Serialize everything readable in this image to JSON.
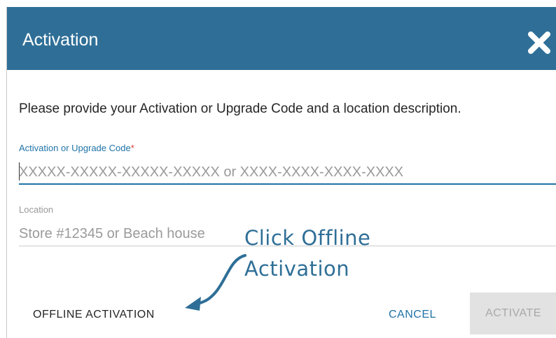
{
  "dialog": {
    "title": "Activation",
    "close_icon": "close-icon",
    "prompt": "Please provide your Activation or Upgrade Code and a location description.",
    "code_field": {
      "label": "Activation or Upgrade Code",
      "required_marker": "*",
      "placeholder": "XXXXX-XXXXX-XXXXX-XXXXX or XXXX-XXXX-XXXX-XXXX",
      "value": ""
    },
    "location_field": {
      "label": "Location",
      "placeholder": "Store #12345 or Beach house",
      "value": ""
    },
    "buttons": {
      "offline": "OFFLINE ACTIVATION",
      "cancel": "CANCEL",
      "activate": "ACTIVATE"
    }
  },
  "annotation": {
    "line1": "Click Offline",
    "line2": "Activation"
  },
  "colors": {
    "header": "#2f6f97",
    "accent": "#1f73a6",
    "required": "#e53935",
    "disabled_bg": "#e2e2e2",
    "disabled_text": "#a8a8a8"
  }
}
